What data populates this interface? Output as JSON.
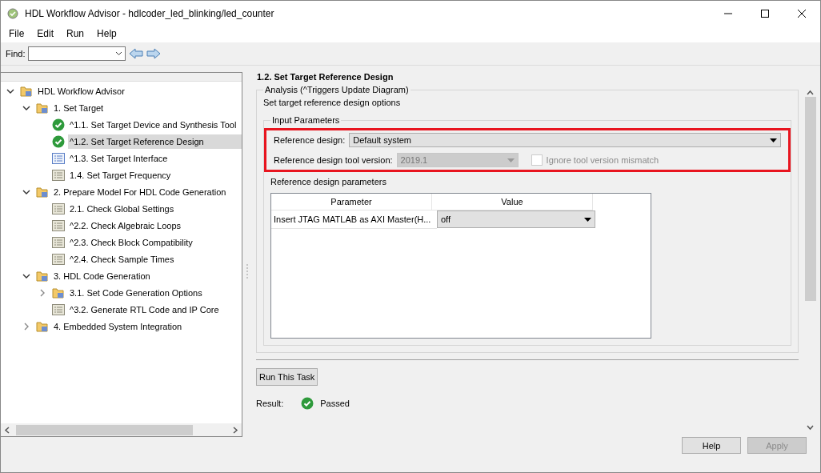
{
  "window": {
    "title": "HDL Workflow Advisor - hdlcoder_led_blinking/led_counter"
  },
  "menu": [
    "File",
    "Edit",
    "Run",
    "Help"
  ],
  "toolbar": {
    "find_label": "Find:"
  },
  "tree": [
    {
      "label": "HDL Workflow Advisor",
      "kind": "folder",
      "expanded": true,
      "selected": false,
      "children": [
        {
          "label": "1. Set Target",
          "kind": "folder",
          "expanded": true,
          "selected": false,
          "children": [
            {
              "label": "^1.1. Set Target Device and Synthesis Tool",
              "kind": "passed",
              "selected": false
            },
            {
              "label": "^1.2. Set Target Reference Design",
              "kind": "passed",
              "selected": true
            },
            {
              "label": "^1.3. Set Target Interface",
              "kind": "pending",
              "selected": false
            },
            {
              "label": "1.4. Set Target Frequency",
              "kind": "task",
              "selected": false
            }
          ]
        },
        {
          "label": "2. Prepare Model For HDL Code Generation",
          "kind": "folder",
          "expanded": true,
          "selected": false,
          "children": [
            {
              "label": "2.1. Check Global Settings",
              "kind": "task",
              "selected": false
            },
            {
              "label": "^2.2. Check Algebraic Loops",
              "kind": "task",
              "selected": false
            },
            {
              "label": "^2.3. Check Block Compatibility",
              "kind": "task",
              "selected": false
            },
            {
              "label": "^2.4. Check Sample Times",
              "kind": "task",
              "selected": false
            }
          ]
        },
        {
          "label": "3. HDL Code Generation",
          "kind": "folder",
          "expanded": true,
          "selected": false,
          "children": [
            {
              "label": "3.1. Set Code Generation Options",
              "kind": "folder",
              "expanded": false,
              "selected": false
            },
            {
              "label": "^3.2. Generate RTL Code and IP Core",
              "kind": "task",
              "selected": false
            }
          ]
        },
        {
          "label": "4. Embedded System Integration",
          "kind": "folder",
          "expanded": false,
          "selected": false
        }
      ]
    }
  ],
  "task": {
    "title": "1.2. Set Target Reference Design",
    "analysis_legend": "Analysis (^Triggers Update Diagram)",
    "description": "Set target reference design options",
    "input_parameters": {
      "legend": "Input Parameters",
      "highlighted": true,
      "reference_design": {
        "label": "Reference design:",
        "value": "Default system"
      },
      "tool_version": {
        "label": "Reference design tool version:",
        "value": "2019.1",
        "disabled": true
      },
      "ignore_mismatch": {
        "label": "Ignore tool version mismatch",
        "checked": false,
        "disabled": true
      },
      "parameters_label": "Reference design parameters",
      "table": {
        "columns": [
          "Parameter",
          "Value"
        ],
        "rows": [
          {
            "parameter": "Insert JTAG MATLAB as AXI Master(H...",
            "value": "off"
          }
        ]
      }
    },
    "run_button": "Run This Task",
    "result": {
      "label": "Result:",
      "text": "Passed"
    }
  },
  "buttons": [
    {
      "label": "Help",
      "disabled": false
    },
    {
      "label": "Apply",
      "disabled": true
    }
  ]
}
